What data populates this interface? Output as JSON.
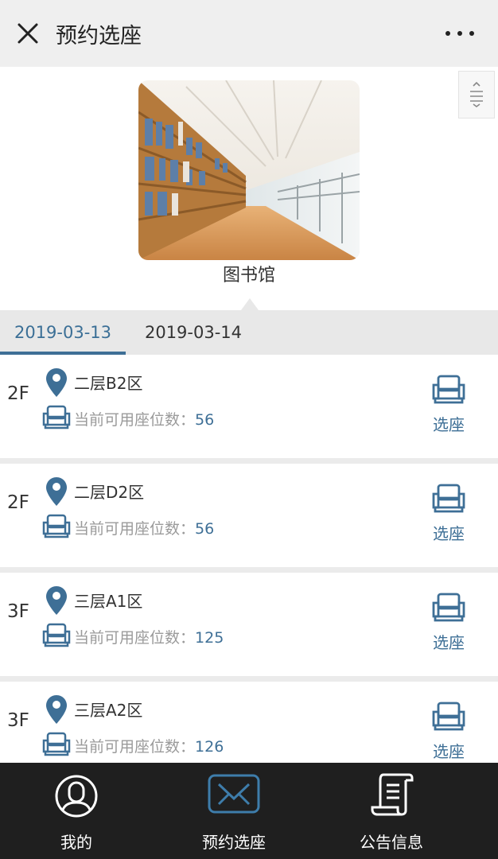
{
  "header": {
    "title": "预约选座",
    "close_icon": "close-icon",
    "more_icon": "more-dots-icon"
  },
  "banner": {
    "library_name": "图书馆",
    "image": "library-bookshelves-photo"
  },
  "tabs": [
    {
      "label": "2019-03-13",
      "active": true
    },
    {
      "label": "2019-03-14",
      "active": false
    }
  ],
  "areas": [
    {
      "floor": "2F",
      "name": "二层B2区",
      "available_label": "当前可用座位数：",
      "available": "56",
      "action": "选座"
    },
    {
      "floor": "2F",
      "name": "二层D2区",
      "available_label": "当前可用座位数：",
      "available": "56",
      "action": "选座"
    },
    {
      "floor": "3F",
      "name": "三层A1区",
      "available_label": "当前可用座位数：",
      "available": "125",
      "action": "选座"
    },
    {
      "floor": "3F",
      "name": "三层A2区",
      "available_label": "当前可用座位数：",
      "available": "126",
      "action": "选座"
    }
  ],
  "bottom_nav": [
    {
      "label": "我的",
      "icon": "user-icon"
    },
    {
      "label": "预约选座",
      "icon": "envelope-icon"
    },
    {
      "label": "公告信息",
      "icon": "notice-scroll-icon"
    }
  ],
  "colors": {
    "accent": "#3e6f96",
    "nav_bg": "#1f1f1f",
    "header_bg": "#efefef"
  }
}
